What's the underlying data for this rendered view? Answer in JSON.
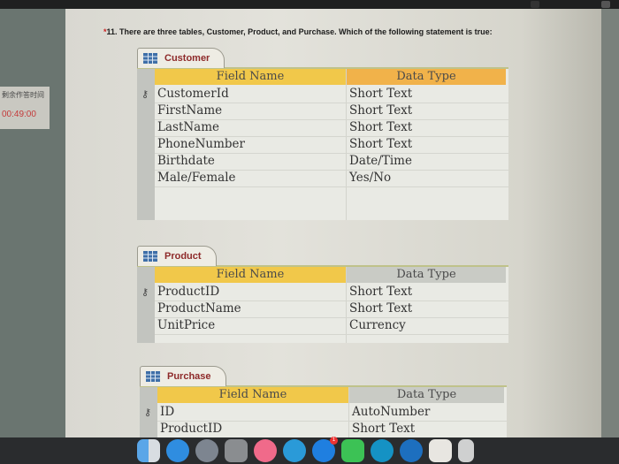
{
  "left_panel": {
    "timer_label": "剩余作答时间",
    "timer_value": "00:49:00"
  },
  "question": {
    "marker": "*",
    "text": "11. There are three tables, Customer, Product, and Purchase. Which of the following statement is true:"
  },
  "tables": [
    {
      "name": "Customer",
      "headers": {
        "field": "Field Name",
        "type": "Data Type"
      },
      "rows": [
        {
          "field": "CustomerId",
          "type": "Short Text",
          "primary_key": true
        },
        {
          "field": "FirstName",
          "type": "Short Text",
          "primary_key": false
        },
        {
          "field": "LastName",
          "type": "Short Text",
          "primary_key": false
        },
        {
          "field": "PhoneNumber",
          "type": "Short Text",
          "primary_key": false
        },
        {
          "field": "Birthdate",
          "type": "Date/Time",
          "primary_key": false
        },
        {
          "field": "Male/Female",
          "type": "Yes/No",
          "primary_key": false
        }
      ]
    },
    {
      "name": "Product",
      "headers": {
        "field": "Field Name",
        "type": "Data Type"
      },
      "rows": [
        {
          "field": "ProductID",
          "type": "Short Text",
          "primary_key": true
        },
        {
          "field": "ProductName",
          "type": "Short Text",
          "primary_key": false
        },
        {
          "field": "UnitPrice",
          "type": "Currency",
          "primary_key": false
        }
      ]
    },
    {
      "name": "Purchase",
      "headers": {
        "field": "Field Name",
        "type": "Data Type"
      },
      "rows": [
        {
          "field": "ID",
          "type": "AutoNumber",
          "primary_key": true
        },
        {
          "field": "ProductID",
          "type": "Short Text",
          "primary_key": false
        }
      ]
    }
  ],
  "icons": {
    "table_icon": "table-grid-icon",
    "key_icon": "primary-key-icon",
    "key_glyph": "⚷"
  },
  "dock": {
    "apps": [
      "Finder",
      "Safari",
      "Launchpad",
      "System Preferences",
      "Music",
      "Messages",
      "App Store",
      "FaceTime",
      "Edge",
      "Migration",
      "Chrome",
      "Trash"
    ],
    "app_store_badge": "1"
  },
  "colors": {
    "header_field": "#f1c84a",
    "header_type_active": "#f1b24a",
    "tab_text": "#8e2a2a",
    "timer": "#c43a3a"
  }
}
